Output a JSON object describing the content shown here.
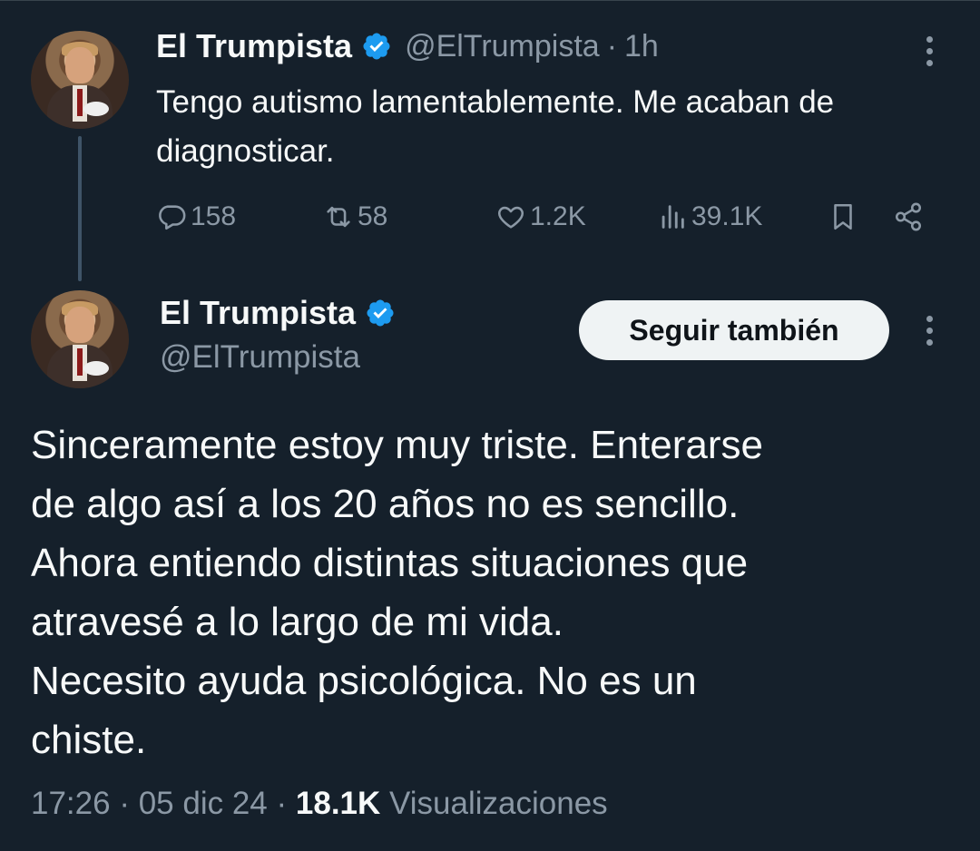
{
  "tweet1": {
    "name": "El Trumpista",
    "handle": "@ElTrumpista",
    "separator": "·",
    "time": "1h",
    "text": "Tengo autismo lamentablemente. Me acaban de diagnosticar.",
    "replies": "158",
    "retweets": "58",
    "likes": "1.2K",
    "views": "39.1K"
  },
  "tweet2": {
    "name": "El Trumpista",
    "handle": "@ElTrumpista",
    "follow_label": "Seguir también",
    "lines": [
      "Sinceramente estoy muy triste. Enterarse",
      "de algo así a los 20 años no es sencillo.",
      "Ahora entiendo distintas situaciones que",
      "atravesé a lo largo de mi vida.",
      "Necesito ayuda psicológica. No es un",
      "chiste."
    ],
    "time": "17:26",
    "date": "05 dic 24",
    "views_count": "18.1K",
    "views_label": "Visualizaciones",
    "separator": "·"
  },
  "colors": {
    "background": "#15202b",
    "verified": "#1d9bf0",
    "secondary_text": "#8b98a5",
    "primary_text": "#f7f9f9"
  }
}
